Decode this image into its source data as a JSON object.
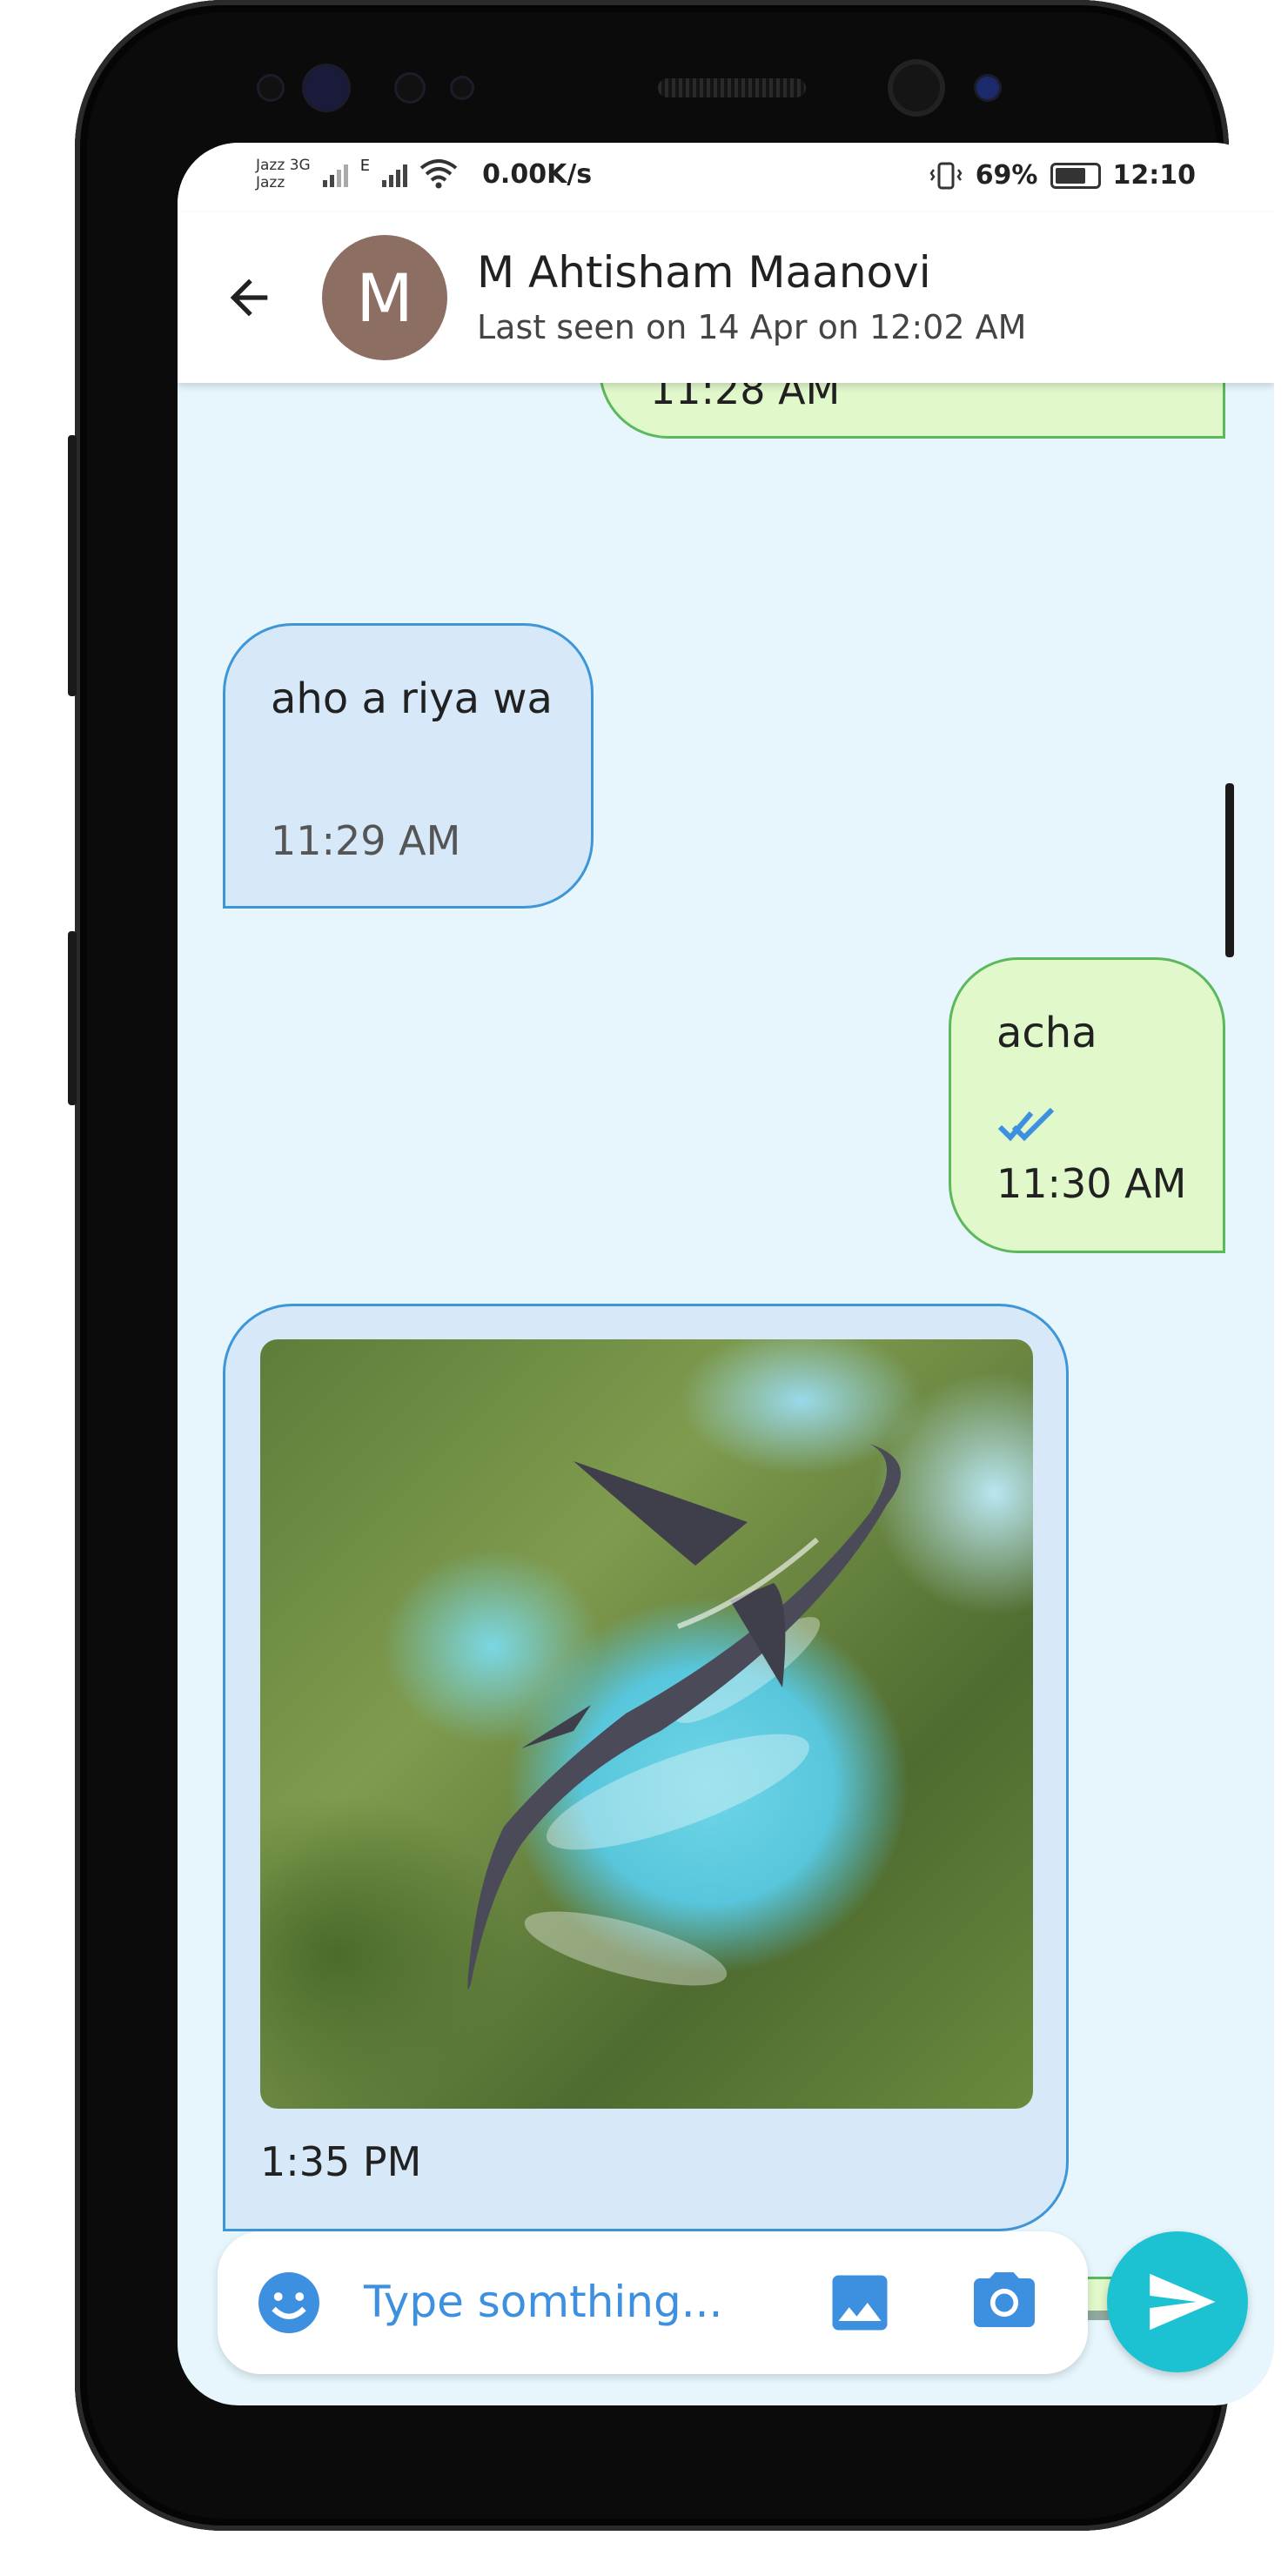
{
  "status_bar": {
    "carrier_top": "Jazz",
    "network_type": "3G",
    "carrier_bottom": "Jazz",
    "edge_label": "E",
    "speed": "0.00K/s",
    "battery_percent": "69%",
    "time": "12:10"
  },
  "contact": {
    "avatar_initial": "M",
    "name": "M Ahtisham Maanovi",
    "last_seen": "Last seen on 14 Apr on 12:02 AM"
  },
  "messages": [
    {
      "direction": "outgoing",
      "text": "",
      "time": "11:28 AM"
    },
    {
      "direction": "incoming",
      "text": "aho a riya wa",
      "time": "11:29 AM"
    },
    {
      "direction": "outgoing",
      "text": "acha",
      "time": "11:30 AM",
      "read": true
    },
    {
      "direction": "incoming",
      "type": "image",
      "time": "1:35 PM"
    },
    {
      "direction": "outgoing",
      "type": "image",
      "time": ""
    }
  ],
  "composer": {
    "placeholder": "Type somthing..."
  },
  "colors": {
    "chat_background": "#e7f6fd",
    "incoming_bubble": "#d7e9f9",
    "incoming_border": "#3f96d6",
    "outgoing_bubble": "#e1f8cb",
    "outgoing_border": "#5cb85c",
    "accent_blue": "#3d8fe0",
    "send_button": "#1cc2d2",
    "avatar": "#8d6e63"
  },
  "icons": [
    "back-arrow-icon",
    "read-receipt-icon",
    "emoji-icon",
    "gallery-icon",
    "camera-icon",
    "send-icon"
  ]
}
